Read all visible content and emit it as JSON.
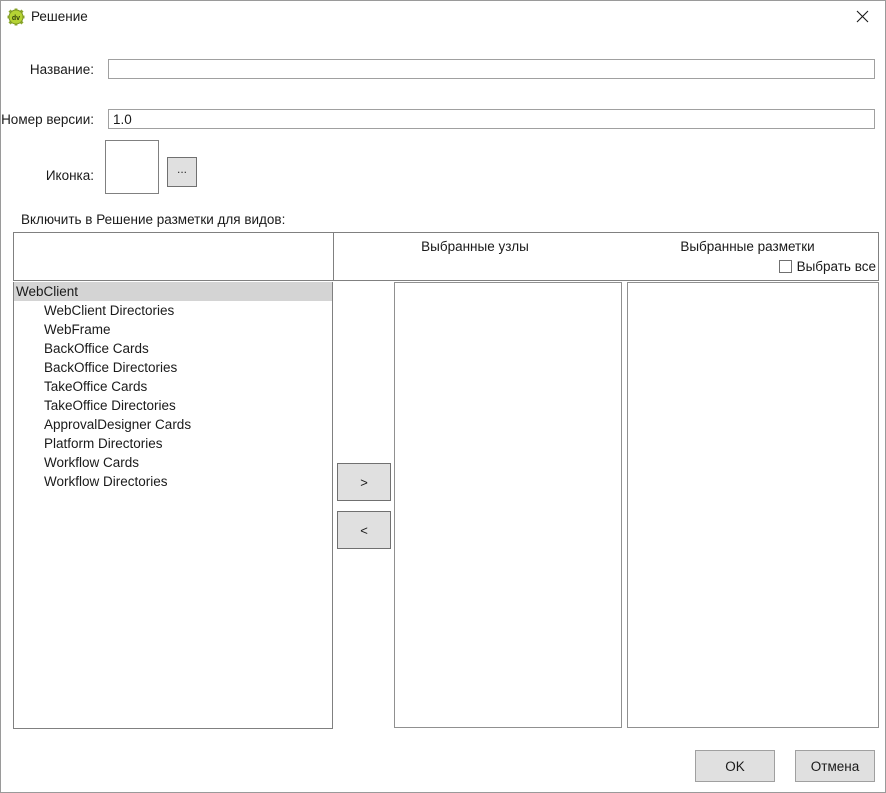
{
  "window": {
    "title": "Решение",
    "icon": "gear-icon",
    "icon_label": "dv",
    "icon_color": "#a4c62e",
    "close_icon": "close-icon"
  },
  "form": {
    "name": {
      "label": "Название:",
      "value": "",
      "placeholder": ""
    },
    "version": {
      "label": "Номер версии:",
      "value": "1.0",
      "placeholder": ""
    },
    "icon": {
      "label": "Иконка:",
      "browse_label": "..."
    }
  },
  "section": {
    "caption": "Включить в Решение разметки для видов:"
  },
  "headers": {
    "selected_nodes": "Выбранные узлы",
    "selected_layouts": "Выбранные разметки",
    "select_all": "Выбрать все",
    "select_all_checked": false
  },
  "tree": {
    "root": "WebClient",
    "items": [
      "WebClient Directories",
      "WebFrame",
      "BackOffice Cards",
      "BackOffice Directories",
      "TakeOffice Cards",
      "TakeOffice Directories",
      "ApprovalDesigner Cards",
      "Platform Directories",
      "Workflow Cards",
      "Workflow Directories"
    ]
  },
  "transfer": {
    "add_label": ">",
    "remove_label": "<"
  },
  "lists": {
    "selected_nodes_items": [],
    "selected_layouts_items": []
  },
  "footer": {
    "ok_label": "OK",
    "cancel_label": "Отмена"
  },
  "colors": {
    "selection": "#d4d4d4",
    "button_face": "#e0e0e0",
    "border": "#808080"
  }
}
